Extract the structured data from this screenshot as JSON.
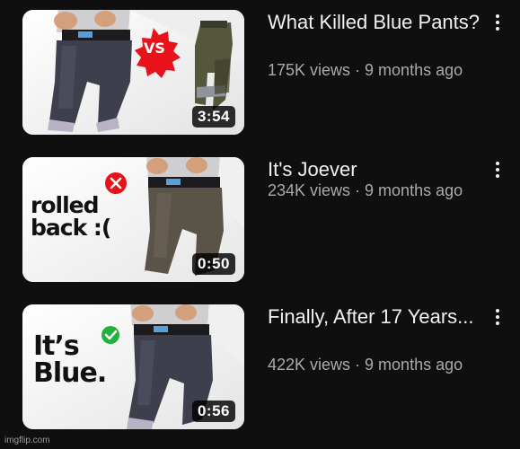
{
  "videos": [
    {
      "title": "What Killed Blue Pants?",
      "meta": "175K views · 9 months ago",
      "duration": "3:54",
      "thumb_badge": "VS",
      "thumb_lines": [],
      "badge_color": "#e8131a"
    },
    {
      "title": "It's Joever",
      "meta": "234K views · 9 months ago",
      "duration": "0:50",
      "thumb_badge": "",
      "thumb_lines": [
        "rolled",
        "back :("
      ],
      "badge_color": "#e8131a"
    },
    {
      "title": "Finally, After 17 Years...",
      "meta": "422K views · 9 months ago",
      "duration": "0:56",
      "thumb_badge": "",
      "thumb_lines": [
        "It’s",
        "Blue."
      ],
      "badge_color": "#22b13c"
    }
  ],
  "icons": {
    "more": "kebab-vertical-icon",
    "rejected": "x-circle-icon",
    "approved": "check-circle-icon"
  },
  "watermark": "imgflip.com"
}
